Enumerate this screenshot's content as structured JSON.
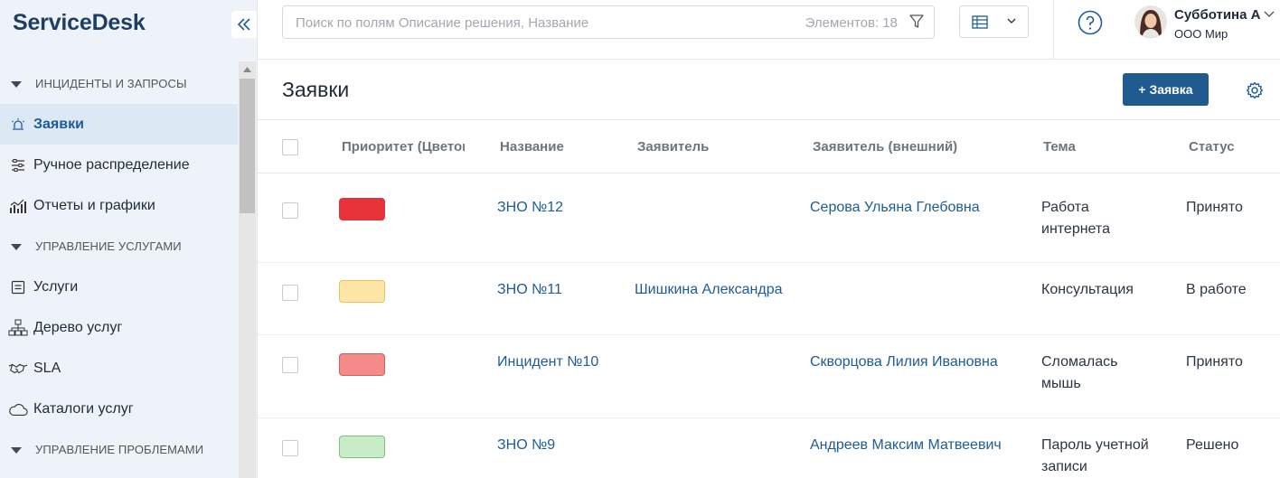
{
  "app": {
    "title": "ServiceDesk"
  },
  "sidebar": {
    "sections": [
      {
        "label": "ИНЦИДЕНТЫ И ЗАПРОСЫ"
      },
      {
        "label": "УПРАВЛЕНИЕ УСЛУГАМИ"
      },
      {
        "label": "УПРАВЛЕНИЕ ПРОБЛЕМАМИ"
      }
    ],
    "items": [
      {
        "label": "Заявки",
        "icon": "alarm-icon",
        "active": true
      },
      {
        "label": "Ручное распределение",
        "icon": "list-settings-icon"
      },
      {
        "label": "Отчеты и графики",
        "icon": "chart-icon"
      },
      {
        "label": "Услуги",
        "icon": "service-icon"
      },
      {
        "label": "Дерево услуг",
        "icon": "tree-icon"
      },
      {
        "label": "SLA",
        "icon": "handshake-icon"
      },
      {
        "label": "Каталоги услуг",
        "icon": "cloud-icon"
      }
    ]
  },
  "topbar": {
    "search_placeholder": "Поиск по полям Описание решения, Название",
    "elements_count": "Элементов: 18",
    "user": {
      "name": "Субботина А",
      "org": "ООО Мир"
    }
  },
  "page": {
    "title": "Заявки",
    "add_button": "+ Заявка"
  },
  "table": {
    "columns": [
      "Приоритет (Цветовой)",
      "Название",
      "Заявитель",
      "Заявитель (внешний)",
      "Тема",
      "Статус"
    ],
    "rows": [
      {
        "priority_color": "#e8323a",
        "name": "ЗНО №12",
        "applicant": "",
        "external": "Серова Ульяна Глебовна",
        "topic": "Работа интернета",
        "status": "Принято"
      },
      {
        "priority_color": "#fde5a6",
        "name": "ЗНО №11",
        "applicant": "Шишкина Александра",
        "external": "",
        "topic": "Консультация",
        "status": "В работе"
      },
      {
        "priority_color": "#f58a8a",
        "name": "Инцидент №10",
        "applicant": "",
        "external": "Скворцова Лилия Ивановна",
        "topic": "Сломалась мышь",
        "status": "Принято"
      },
      {
        "priority_color": "#c7ecc7",
        "name": "ЗНО №9",
        "applicant": "",
        "external": "Андреев Максим Матвеевич",
        "topic": "Пароль учетной записи",
        "status": "Решено"
      }
    ]
  },
  "colors": {
    "accent": "#205a8f",
    "link": "#1d5c96",
    "sidebar_bg": "#eef3f9"
  }
}
